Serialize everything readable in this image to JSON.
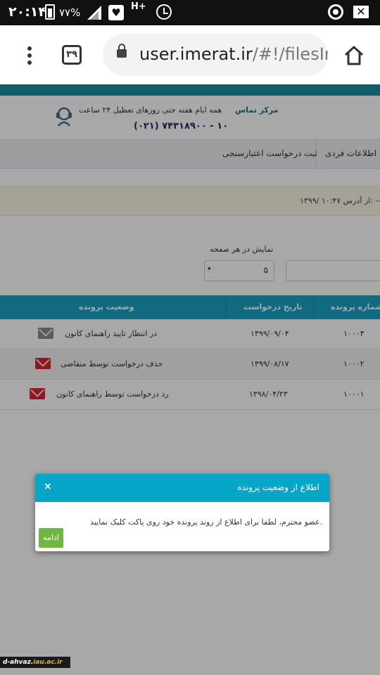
{
  "status_bar": {
    "time": "۲۰:۱۴",
    "battery": "۷۷%",
    "network": "H+",
    "icons": [
      "battery-icon",
      "signal-icon",
      "heart-icon",
      "alarm-icon",
      "chrome-icon",
      "mail-icon"
    ]
  },
  "browser": {
    "tab_count": "۳۹",
    "url_host": "user.imerat.ir",
    "url_path": "/#!/filesInfo"
  },
  "contact": {
    "title": "مرکز تماس",
    "desc": "همه ایام هفته حتی روزهای تعطیل ۲۴ ساعت",
    "phone": "(۰۲۱) ۷۴۳۱۸۹۰۰ - ۱۰"
  },
  "nav": {
    "item1": "ت اطلاعات فردی",
    "item2": "ثبت درخواست اعتبارسنجی"
  },
  "notice": {
    "text": "۱۳۹۹/ ۱۰:۴۷ از آدرس: ---"
  },
  "table_controls": {
    "per_page_label": "نمایش در هر صفحه",
    "per_page_value": "۵",
    "arrow": "▾"
  },
  "table": {
    "headers": {
      "file_no": "شماره پرونده",
      "request_date": "تاریخ درخواست",
      "status": "وضعیت پرونده"
    },
    "rows": [
      {
        "file_no": "۱۰۰۰۳",
        "date": "۱۳۹۹/۰۹/۰۴",
        "status": "در انتظار تایید راهنمای کانون",
        "icon_color": "#8a8a8a"
      },
      {
        "file_no": "۱۰۰۰۲",
        "date": "۱۳۹۹/۰۸/۱۷",
        "status": "حذف درخواست توسط متقاضی",
        "icon_color": "#d9232d"
      },
      {
        "file_no": "۱۰۰۰۱",
        "date": "۱۳۹۸/۰۴/۲۳",
        "status": "رد درخواست توسط راهنمای کانون",
        "icon_color": "#d9232d"
      }
    ]
  },
  "modal": {
    "title": "اطلاع از وضعیت پرونده",
    "close": "×",
    "body": "عضو محترم، لطفا برای اطلاع از روند پرونده خود روی پاکت کلیک نمایید.",
    "button": "ادامه"
  },
  "watermark": {
    "text_a": "d-ahvaz.",
    "text_b": "iau.ac.ir"
  },
  "colors": {
    "header_teal": "#1aa3c2",
    "modal_head": "#06a6c8",
    "button_green": "#6fb73f",
    "icon_red": "#d9232d",
    "icon_gray": "#8a8a8a"
  }
}
